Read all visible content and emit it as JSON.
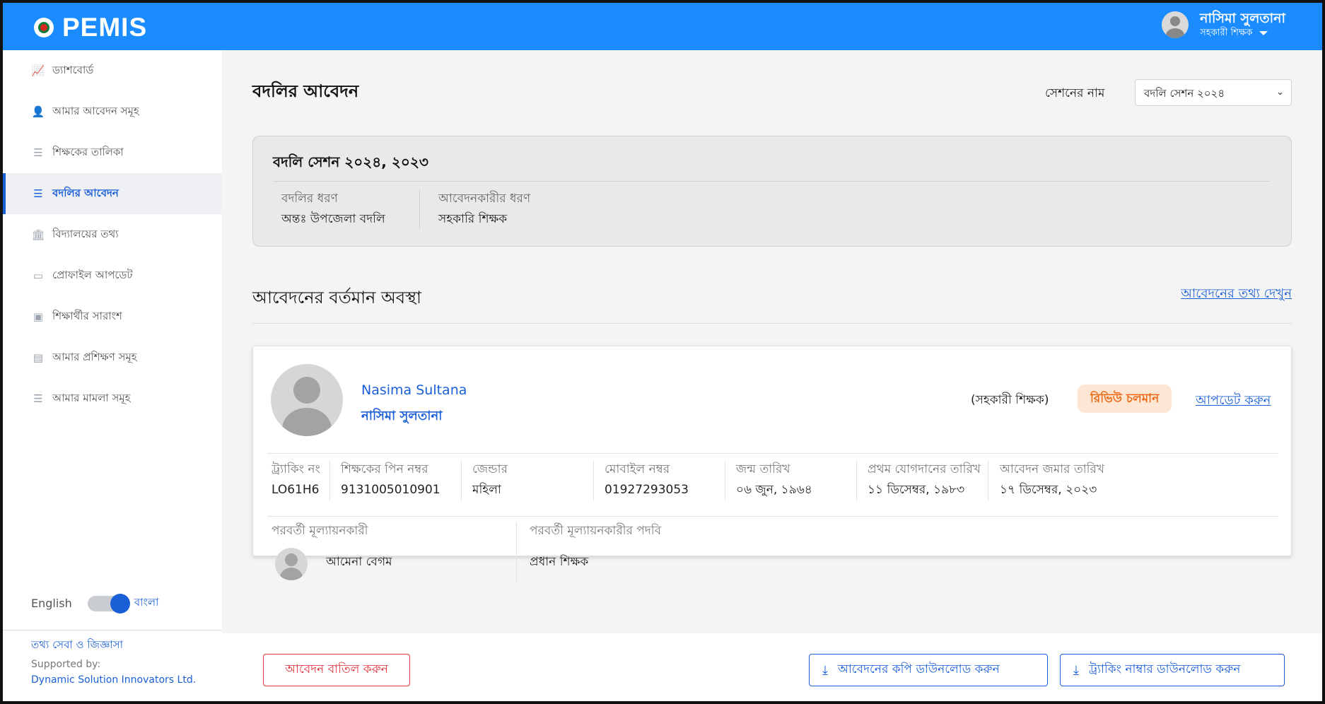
{
  "app": {
    "name": "PEMIS"
  },
  "user": {
    "name": "নাসিমা সুলতানা",
    "role": "সহকারী শিক্ষক"
  },
  "sidebar": {
    "items": [
      {
        "label": "ড্যাশবোর্ড",
        "icon": "chart-line-icon"
      },
      {
        "label": "আমার আবেদন সমূহ",
        "icon": "user-icon"
      },
      {
        "label": "শিক্ষকের তালিকা",
        "icon": "list-icon"
      },
      {
        "label": "বদলির আবেদন",
        "icon": "list-icon",
        "active": true
      },
      {
        "label": "বিদ্যালয়ের তথ্য",
        "icon": "school-icon"
      },
      {
        "label": "প্রোফাইল আপডেট",
        "icon": "profile-icon"
      },
      {
        "label": "শিক্ষার্থীর সারাংশ",
        "icon": "id-card-icon"
      },
      {
        "label": "আমার প্রশিক্ষণ সমূহ",
        "icon": "list-icon"
      },
      {
        "label": "আমার মামলা সমূহ",
        "icon": "list-icon"
      }
    ],
    "lang_en": "English",
    "lang_bn": "বাংলা",
    "help": "তথ্য সেবা ও জিজ্ঞাসা",
    "supported_by": "Supported by:",
    "company": "Dynamic Solution Innovators Ltd."
  },
  "page": {
    "title": "বদলির আবেদন",
    "session_label": "সেশনের নাম",
    "session_selected": "বদলি সেশন ২০২৪"
  },
  "session_card": {
    "title": "বদলি সেশন ২০২৪, ২০২৩",
    "transfer_type_label": "বদলির ধরণ",
    "transfer_type_value": "অন্তঃ উপজেলা বদলি",
    "applicant_type_label": "আবেদনকারীর ধরণ",
    "applicant_type_value": "সহকারি শিক্ষক"
  },
  "status": {
    "title": "আবেদনের বর্তমান অবস্থা",
    "view_link": "আবেদনের তথ্য দেখুন"
  },
  "applicant": {
    "name_en": "Nasima Sultana",
    "name_bn": "নাসিমা সুলতানা",
    "role": "(সহকারী শিক্ষক)",
    "status_badge": "রিভিউ চলমান",
    "update_link": "আপডেট করুন",
    "fields": [
      {
        "label": "ট্র্যাকিং নং",
        "value": "LO61H6"
      },
      {
        "label": "শিক্ষকের পিন নম্বর",
        "value": "9131005010901"
      },
      {
        "label": "জেন্ডার",
        "value": "মহিলা"
      },
      {
        "label": "মোবাইল নম্বর",
        "value": "01927293053"
      },
      {
        "label": "জন্ম তারিখ",
        "value": "০৬ জুন, ১৯৬৪"
      },
      {
        "label": "প্রথম যোগদানের তারিখ",
        "value": "১১ ডিসেম্বর, ১৯৮৩"
      },
      {
        "label": "আবেদন জমার তারিখ",
        "value": "১৭ ডিসেম্বর, ২০২৩"
      }
    ],
    "next_evaluator_label": "পরবর্তী মূল্যায়নকারী",
    "next_evaluator_name": "আমেনা বেগম",
    "next_evaluator_post_label": "পরবর্তী মূল্যায়নকারীর পদবি",
    "next_evaluator_post": "প্রধান শিক্ষক"
  },
  "footer": {
    "cancel": "আবেদন বাতিল করুন",
    "download_copy": "আবেদনের কপি ডাউনলোড করুন",
    "download_tracking": "ট্র্যাকিং নাম্বার ডাউনলোড করুন"
  },
  "colors": {
    "primary": "#1a8cff",
    "link": "#1a5fd6",
    "danger": "#e0323a",
    "badge_bg": "#fde7d4",
    "badge_text": "#ec6a16"
  }
}
